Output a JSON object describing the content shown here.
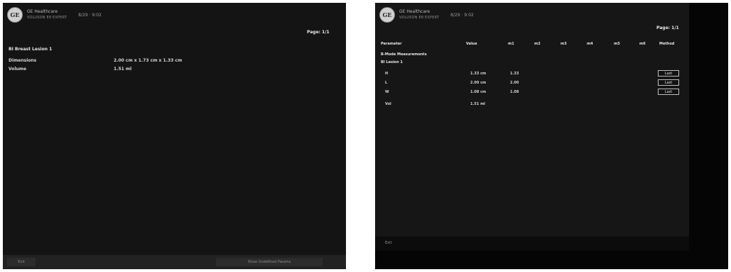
{
  "left_panel": {
    "header": {
      "company": "GE Healthcare",
      "device": "VOLUSON E8 EXPERT",
      "time": "8/29 · 9:02"
    },
    "page_label": "Page: 1/1",
    "section_title": "BI Breast Lesion 1",
    "rows": [
      {
        "label": "Dimensions",
        "value": "2.00 cm x 1.73 cm x 1.33 cm"
      },
      {
        "label": "Volume",
        "value": "1.51 ml"
      }
    ],
    "footer": {
      "left_button": "Exit",
      "right_button": "Show Undefined Params"
    }
  },
  "right_panel": {
    "header": {
      "company": "GE Healthcare",
      "device": "VOLUSON E8 EXPERT",
      "time": "8/29 · 9:02"
    },
    "page_label": "Page: 1/1",
    "columns": [
      "Parameter",
      "Value",
      "m1",
      "m2",
      "m3",
      "m4",
      "m5",
      "m6",
      "Method"
    ],
    "section_title": "B-Mode Measurements",
    "subsection_title": "BI Lesion 1",
    "measurements": [
      {
        "param": "H",
        "value": "1.33 cm",
        "m1": "1.33",
        "method": "Last"
      },
      {
        "param": "L",
        "value": "2.00 cm",
        "m1": "2.00",
        "method": "Last"
      },
      {
        "param": "W",
        "value": "1.08 cm",
        "m1": "1.08",
        "method": "Last"
      },
      {
        "param": "Vol",
        "value": "1.51 ml",
        "m1": "",
        "method": ""
      }
    ],
    "footer": {
      "exit_button": "Exit"
    }
  }
}
